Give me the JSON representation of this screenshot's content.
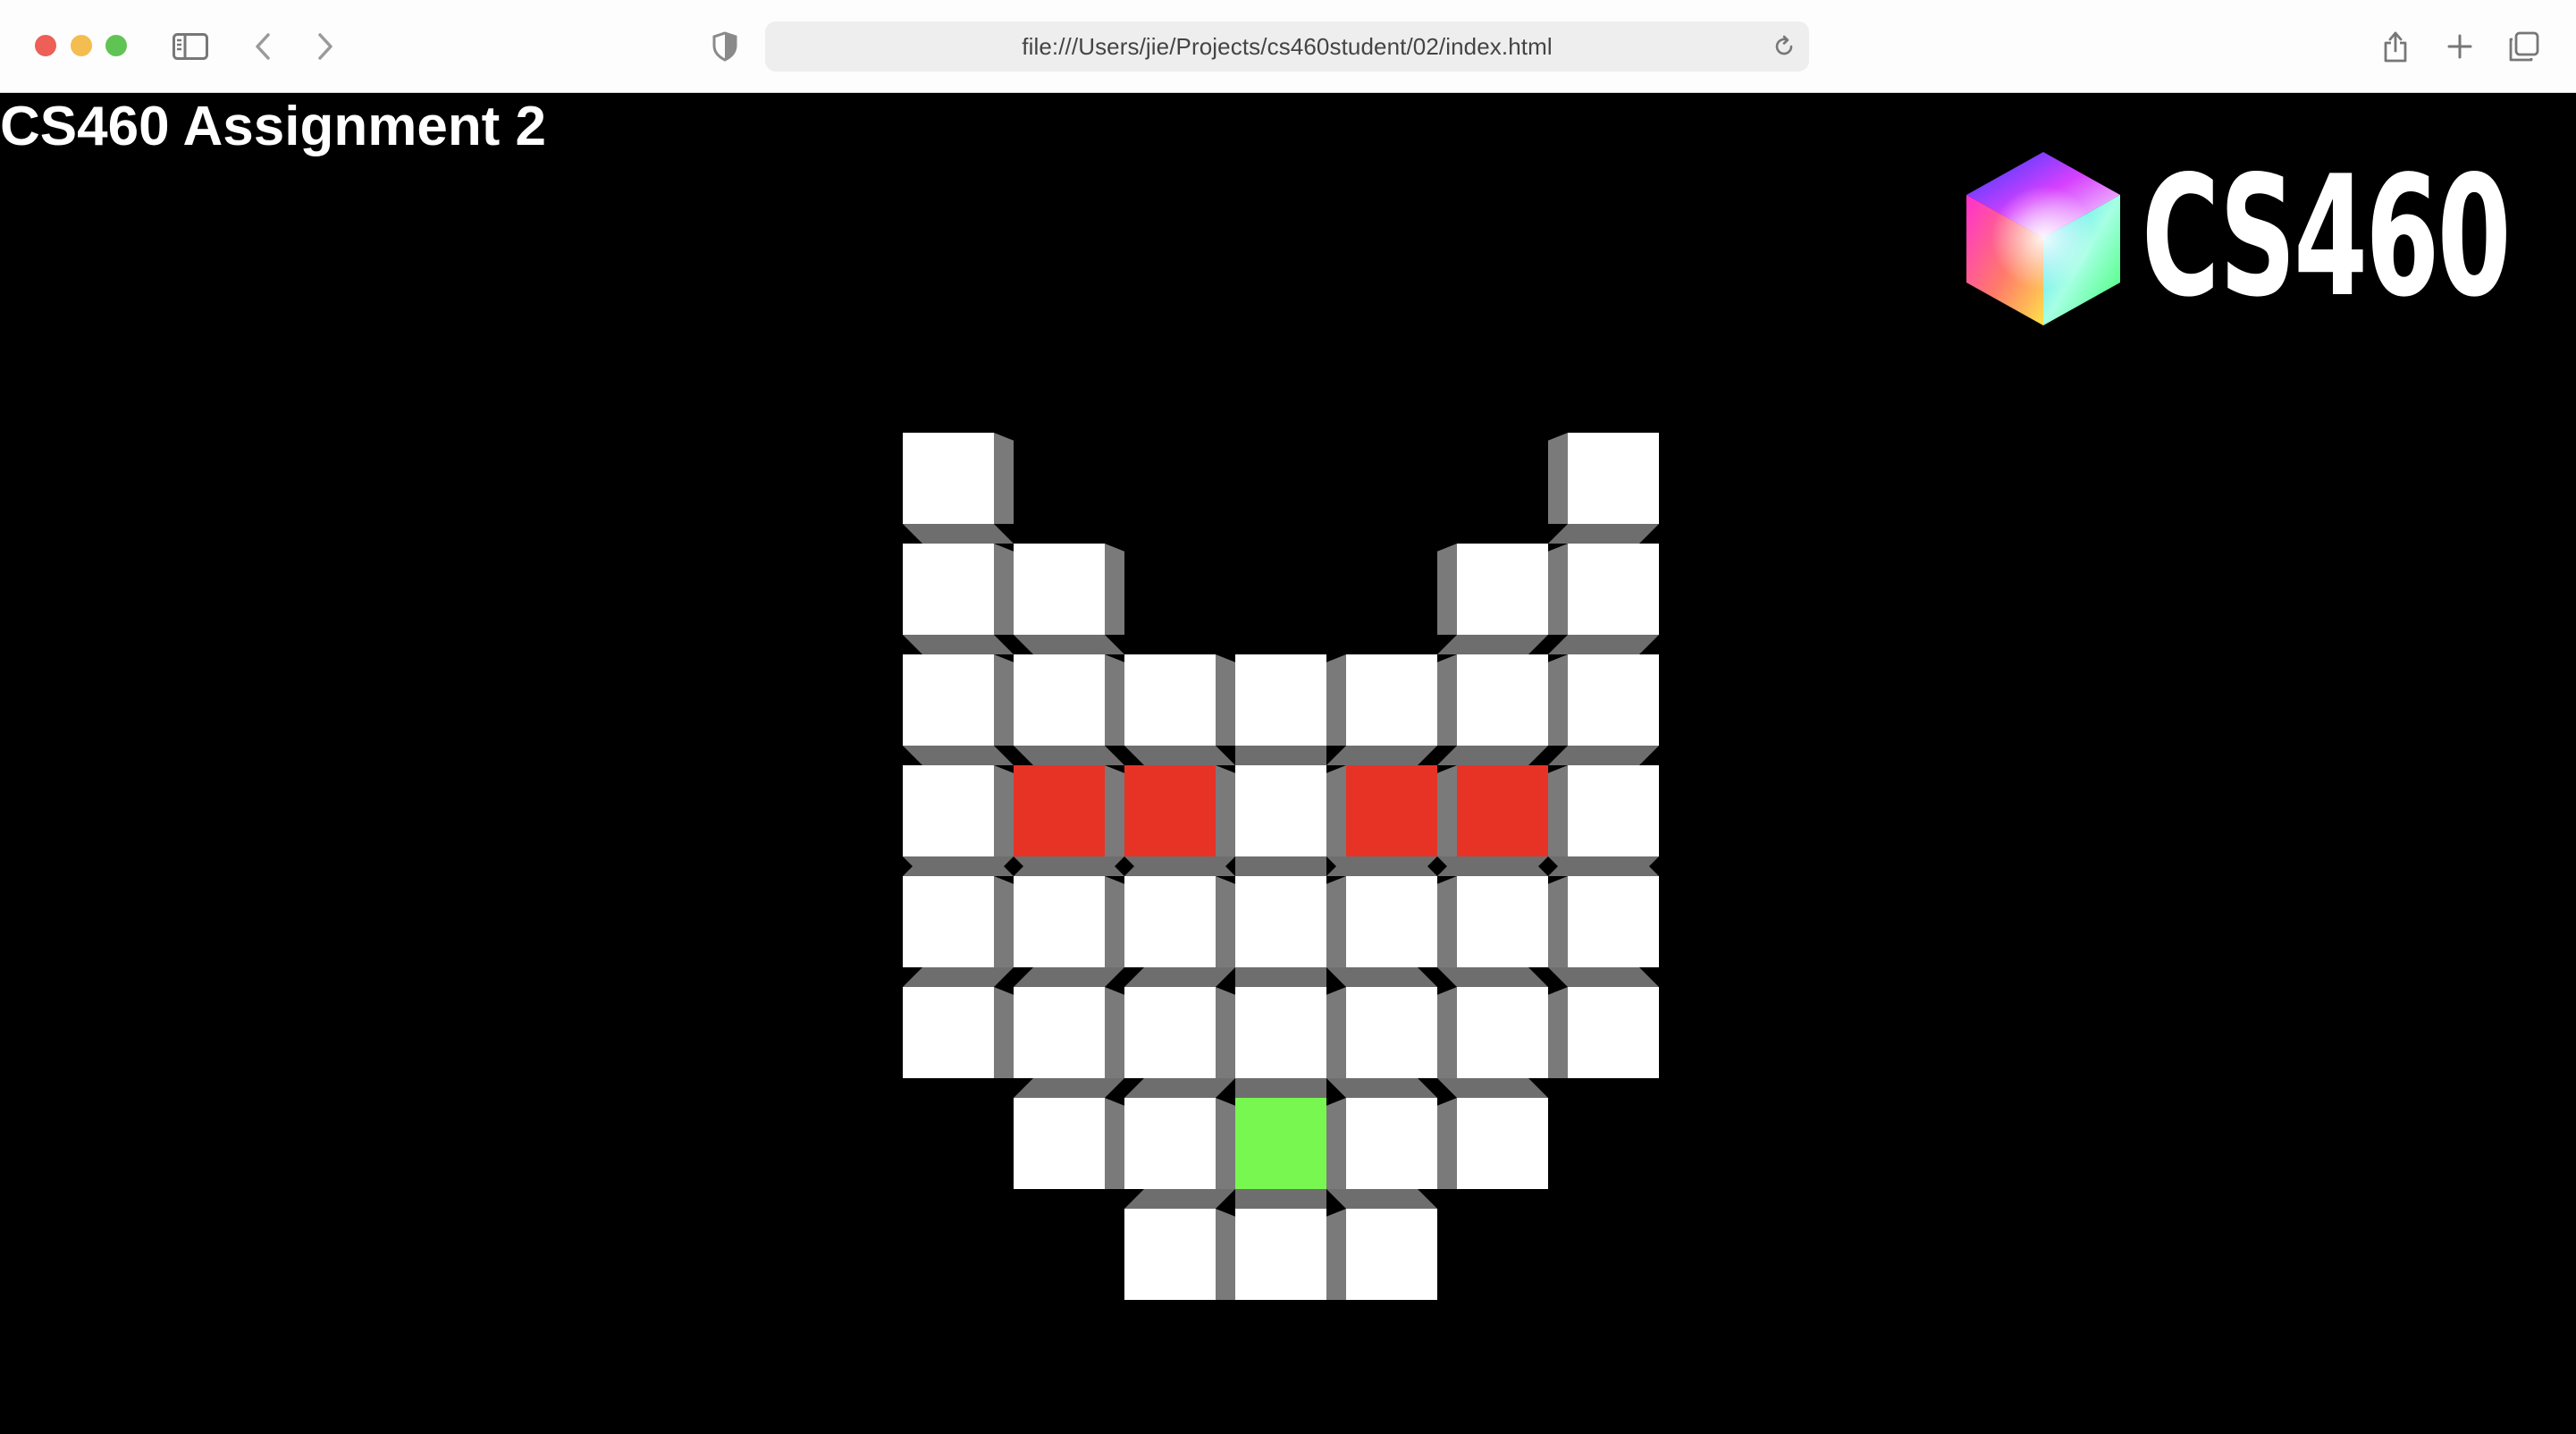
{
  "browser": {
    "url": "file:///Users/jie/Projects/cs460student/02/index.html"
  },
  "page": {
    "title": "CS460 Assignment 2",
    "logo_text": "CS460"
  },
  "grid": {
    "colors": {
      "white": "#ffffff",
      "red": "#e73326",
      "green": "#77f74f"
    },
    "rows": [
      [
        1,
        0,
        0,
        0,
        0,
        0,
        1
      ],
      [
        1,
        1,
        0,
        0,
        0,
        1,
        1
      ],
      [
        1,
        1,
        1,
        1,
        1,
        1,
        1
      ],
      [
        1,
        2,
        2,
        1,
        2,
        2,
        1
      ],
      [
        1,
        1,
        1,
        1,
        1,
        1,
        1
      ],
      [
        1,
        1,
        1,
        1,
        1,
        1,
        1
      ],
      [
        0,
        1,
        1,
        3,
        1,
        1,
        0
      ],
      [
        0,
        0,
        1,
        1,
        1,
        0,
        0
      ]
    ],
    "legend": {
      "0": "empty",
      "1": "white",
      "2": "red",
      "3": "green"
    }
  }
}
